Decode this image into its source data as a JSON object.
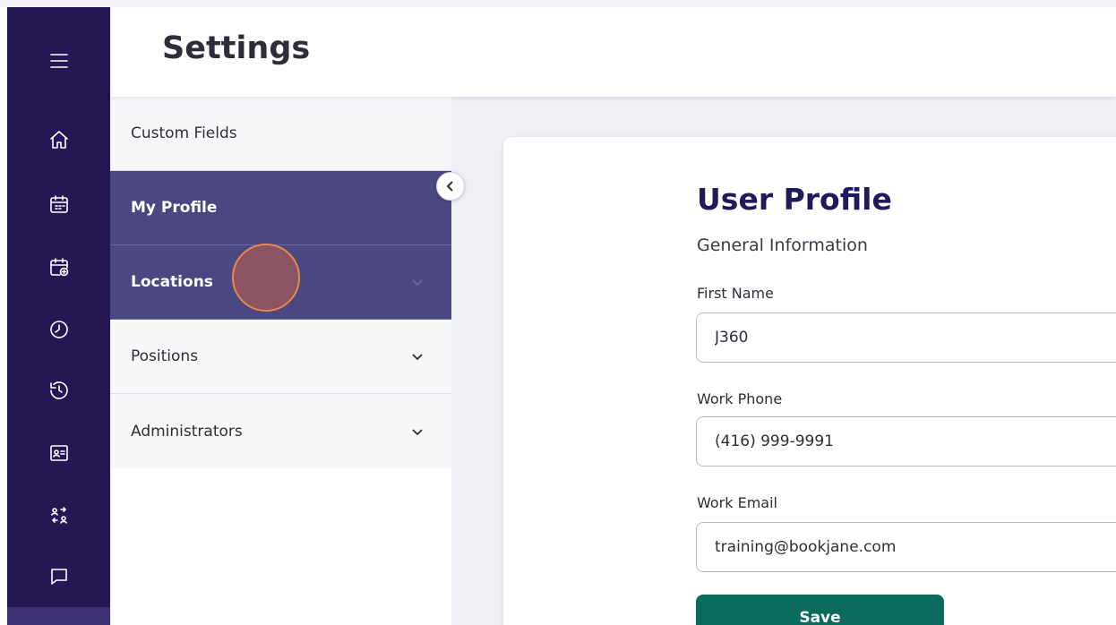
{
  "header": {
    "title": "Settings"
  },
  "rail": {
    "icons": [
      "menu-icon",
      "home-icon",
      "calendar-icon",
      "calendar-add-icon",
      "clock-icon",
      "history-icon",
      "id-card-icon",
      "swap-users-icon",
      "chat-icon"
    ]
  },
  "settings_menu": {
    "items": [
      {
        "label": "Custom Fields",
        "active": false,
        "expandable": false
      },
      {
        "label": "My Profile",
        "active": true,
        "expandable": false
      },
      {
        "label": "Locations",
        "active": true,
        "expandable": true
      },
      {
        "label": "Positions",
        "active": false,
        "expandable": true
      },
      {
        "label": "Administrators",
        "active": false,
        "expandable": true
      }
    ]
  },
  "profile": {
    "title": "User Profile",
    "section": "General Information",
    "fields": [
      {
        "label": "First Name",
        "value": "J360"
      },
      {
        "label": "Work Phone",
        "value": "(416) 999-9991"
      },
      {
        "label": "Work Email",
        "value": "training@bookjane.com"
      }
    ],
    "save_label": "Save"
  },
  "colors": {
    "rail": "#241754",
    "active_menu": "#4b4782",
    "title": "#1f1a5c",
    "save": "#0a6b5c",
    "click_marker": "#e5884a"
  }
}
